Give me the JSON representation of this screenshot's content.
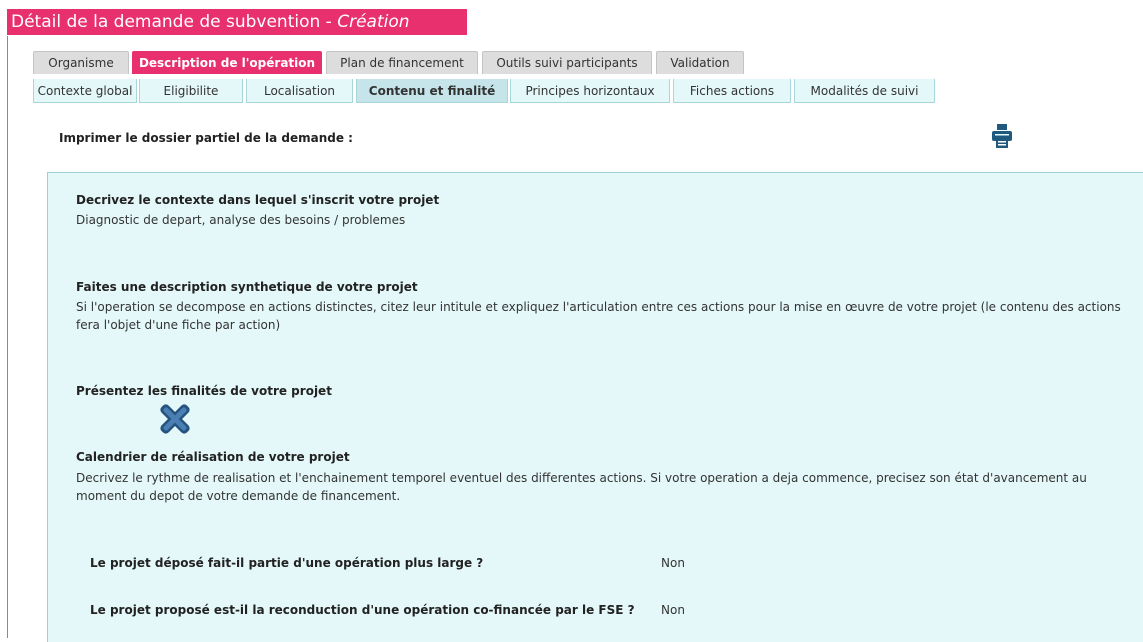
{
  "header": {
    "title": "Détail de la demande de subvention",
    "separator": " - ",
    "mode": "Création"
  },
  "tabs_main": [
    {
      "label": "Organisme",
      "active": false
    },
    {
      "label": "Description de l'opération",
      "active": true
    },
    {
      "label": "Plan de financement",
      "active": false
    },
    {
      "label": "Outils suivi participants",
      "active": false
    },
    {
      "label": "Validation",
      "active": false
    }
  ],
  "tabs_sub": [
    {
      "label": "Contexte global",
      "active": false
    },
    {
      "label": "Eligibilite",
      "active": false
    },
    {
      "label": "Localisation",
      "active": false
    },
    {
      "label": "Contenu et finalité",
      "active": true
    },
    {
      "label": "Principes horizontaux",
      "active": false
    },
    {
      "label": "Fiches actions",
      "active": false
    },
    {
      "label": "Modalités de suivi",
      "active": false
    }
  ],
  "print": {
    "label": "Imprimer le dossier partiel de la demande :",
    "icon": "printer-icon"
  },
  "sections": [
    {
      "title": "Decrivez le contexte dans lequel s'inscrit votre projet",
      "description": "Diagnostic de depart, analyse des besoins / problemes"
    },
    {
      "title": "Faites une description synthetique de votre projet",
      "description": "Si l'operation se decompose en actions distinctes, citez leur intitule et expliquez l'articulation entre ces actions pour la mise en œuvre de votre projet (le contenu des actions fera l'objet d'une fiche par action)"
    },
    {
      "title": "Présentez les finalités de votre projet",
      "description": ""
    },
    {
      "title": "Calendrier de réalisation de votre projet",
      "description": "Decrivez le rythme de realisation et l'enchainement temporel eventuel des differentes actions. Si votre operation a deja commence, precisez son état d'avancement au moment du depot de votre demande de financement."
    }
  ],
  "questions": [
    {
      "label": "Le projet déposé fait-il partie d'une opération plus large ?",
      "value": "Non"
    },
    {
      "label": "Le projet proposé est-il la reconduction d'une opération co-financée par le FSE ?",
      "value": "Non"
    }
  ],
  "icons": {
    "delete": "close-x-icon"
  },
  "colors": {
    "accent": "#e8306e",
    "panel_bg": "#e4f8f9",
    "panel_border": "#9cd2d6",
    "icon_blue": "#24537f"
  }
}
